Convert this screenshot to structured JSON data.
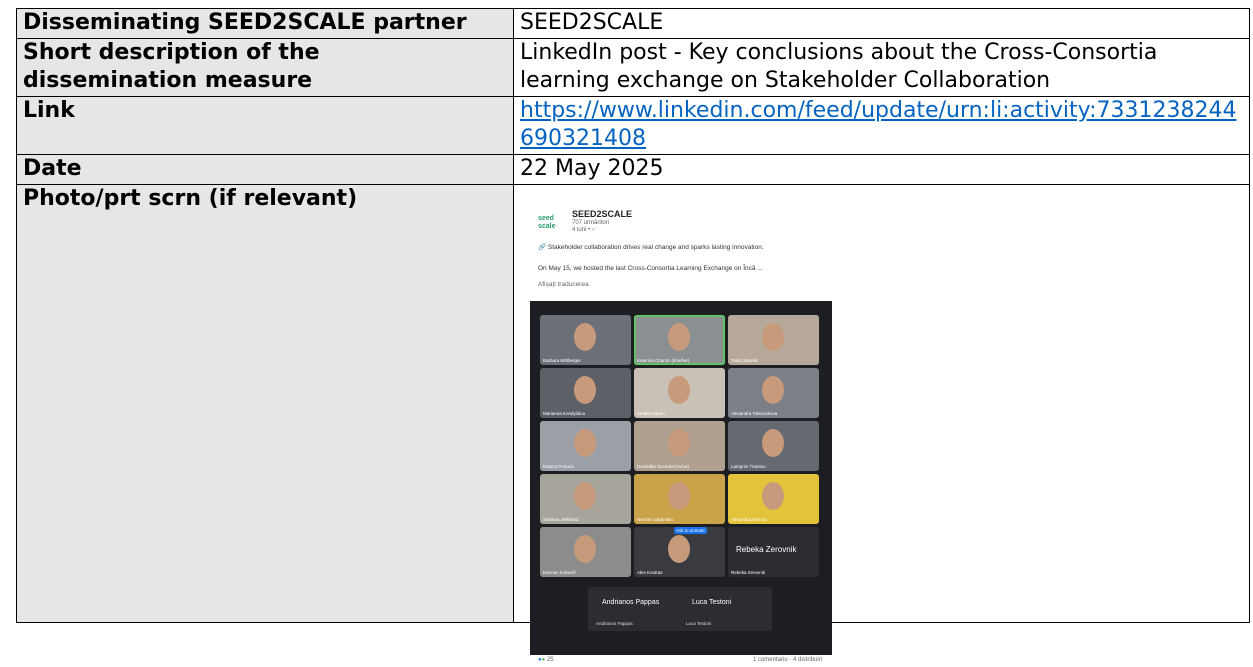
{
  "rows": {
    "partner": {
      "label": "Disseminating SEED2SCALE partner",
      "value": "SEED2SCALE"
    },
    "description": {
      "label_line1": "Short description of the",
      "label_line2": "dissemination measure",
      "value_line1": "LinkedIn post - Key conclusions about the Cross-Consortia",
      "value_line2": "learning exchange on Stakeholder Collaboration"
    },
    "link": {
      "label": "Link",
      "url_line1": "https://www.linkedin.com/feed/update/urn:li:activity:7331238244",
      "url_line2": "690321408"
    },
    "date": {
      "label": "Date",
      "value": "22 May 2025"
    },
    "photo": {
      "label": "Photo/prt scrn (if relevant)"
    }
  },
  "post": {
    "logo_text": "seed scale",
    "org_name": "SEED2SCALE",
    "followers": "707 urmăritori",
    "time": "4 luni • ",
    "line1": "Stakeholder collaboration drives real change and sparks lasting innovation.",
    "line2": "On May 15, we hosted the last Cross-Consortia Learning Exchange on  Încă ...",
    "translate": "Afișați traducerea",
    "participants": [
      "Barbara Wittberger",
      "Katerina Chantzi (she/her)",
      "Tadej Slapnik",
      "Marianna Kondylidou",
      "Amalia Zepou",
      "Alexandra Tolescakova",
      "Raluca Pretuca",
      "Dominika Scereda (Aviva)",
      "Lamprini Triantou",
      "Stefania Jellestad",
      "Nendie Lukjanska",
      "Alexandra Emirza",
      "Karmen Kukovič",
      "Alex Koutras",
      "Rebeka Zerovnik"
    ],
    "big_name": "Rebeka Zerovnik",
    "unmute": "Ask to unmute",
    "lower_names": [
      "Andrianos Pappas",
      "Luca Testoni"
    ],
    "reactions": "25",
    "comments": "1 comentariu · 4 distribuiri"
  }
}
